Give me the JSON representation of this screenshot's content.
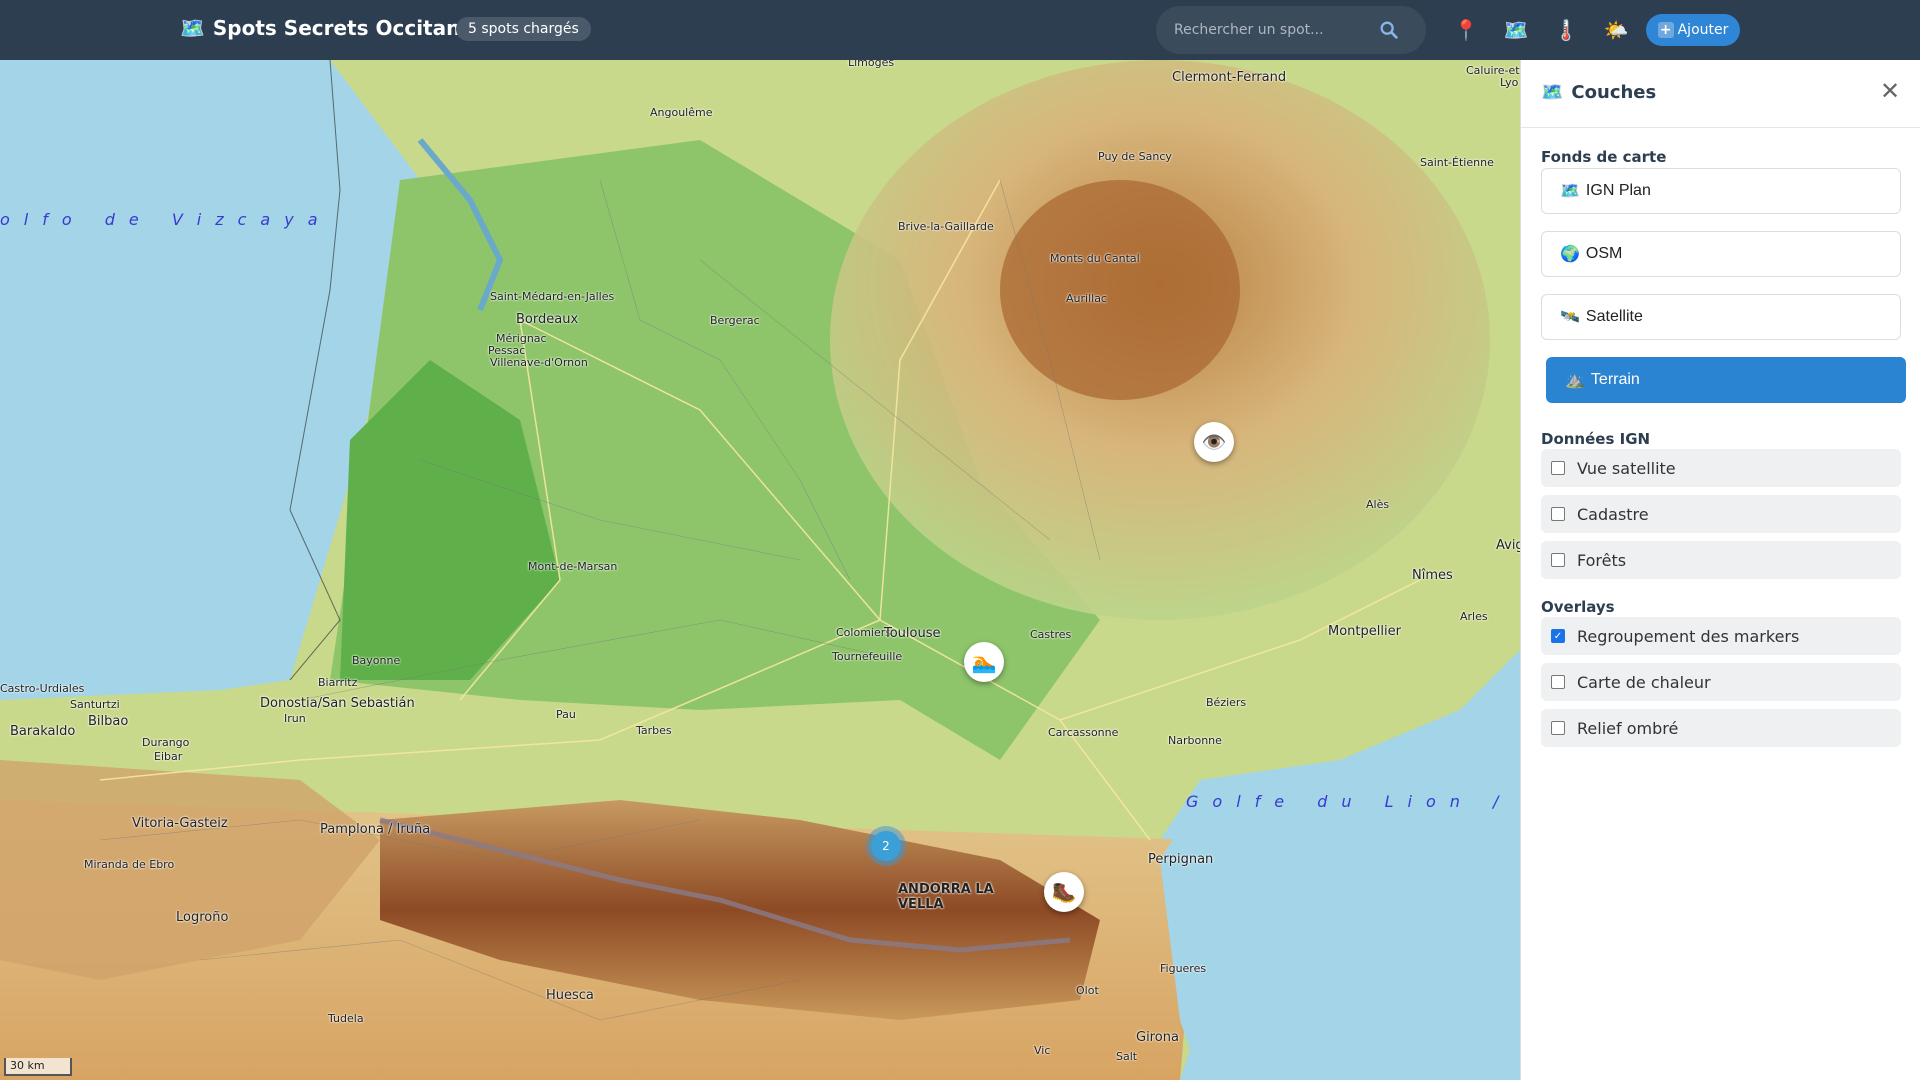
{
  "topbar": {
    "logo_icon": "map-icon",
    "app_title": "Spots Secrets Occitanie",
    "spots_badge": "5 spots chargés",
    "search_placeholder": "Rechercher un spot...",
    "search_icon": "magnifier-icon",
    "tools": [
      {
        "name": "location-pin-icon",
        "glyph": "📍"
      },
      {
        "name": "layers-map-icon",
        "glyph": "🗺️"
      },
      {
        "name": "thermometer-icon",
        "glyph": "🌡️"
      },
      {
        "name": "weather-icon",
        "glyph": "🌤️"
      }
    ],
    "add_label": "Ajouter"
  },
  "map": {
    "scale_label": "30 km",
    "seas": [
      "olfo de Vizcaya",
      "Golfe du Lion / Golfo d"
    ],
    "places": [
      "Limoges",
      "Clermont-Ferrand",
      "Angoulême",
      "Puy de Sancy",
      "Saint-Étienne",
      "Brive-la-Gaillarde",
      "Saint-Médard-en-Jalles",
      "Bordeaux",
      "Mérignac",
      "Pessac",
      "Villenave-d'Ornon",
      "Bergerac",
      "Aurillac",
      "Monts du Cantal",
      "Alès",
      "Nîmes",
      "Arles",
      "Mont-de-Marsan",
      "Colomiers",
      "Toulouse",
      "Tournefeuille",
      "Castres",
      "Montpellier",
      "Bayonne",
      "Biarritz",
      "Donostia/San Sebastián",
      "Irun",
      "Pau",
      "Tarbes",
      "Carcassonne",
      "Béziers",
      "Narbonne",
      "Bilbao",
      "Barakaldo",
      "Santurtzi",
      "Castro-Urdiales",
      "Durango",
      "Eibar",
      "Vitoria-Gasteiz",
      "Pamplona / Iruña",
      "Miranda de Ebro",
      "Logroño",
      "Perpignan",
      "ANDORRA LA VELLA",
      "Figueres",
      "Olot",
      "Huesca",
      "Tudela",
      "Vic",
      "Salt",
      "Girona",
      "Caluire-et-Cuire",
      "Lyo",
      "Avig"
    ],
    "markers": [
      {
        "name": "viewpoint-marker",
        "glyph": "👁️"
      },
      {
        "name": "swimming-marker",
        "glyph": "🏊"
      },
      {
        "name": "hiking-boot-marker",
        "glyph": "🥾"
      }
    ],
    "cluster_count": "2"
  },
  "panel": {
    "icon": "map-icon",
    "title": "Couches",
    "base_section": "Fonds de carte",
    "base_layers": [
      {
        "icon": "🗺️",
        "label": "IGN Plan",
        "active": false
      },
      {
        "icon": "🌍",
        "label": "OSM",
        "active": false
      },
      {
        "icon": "🛰️",
        "label": "Satellite",
        "active": false
      },
      {
        "icon": "⛰️",
        "label": "Terrain",
        "active": true
      }
    ],
    "ign_section": "Données IGN",
    "ign_layers": [
      {
        "label": "Vue satellite",
        "checked": false
      },
      {
        "label": "Cadastre",
        "checked": false
      },
      {
        "label": "Forêts",
        "checked": false
      }
    ],
    "overlays_section": "Overlays",
    "overlays": [
      {
        "label": "Regroupement des markers",
        "checked": true
      },
      {
        "label": "Carte de chaleur",
        "checked": false
      },
      {
        "label": "Relief ombré",
        "checked": false
      }
    ]
  }
}
